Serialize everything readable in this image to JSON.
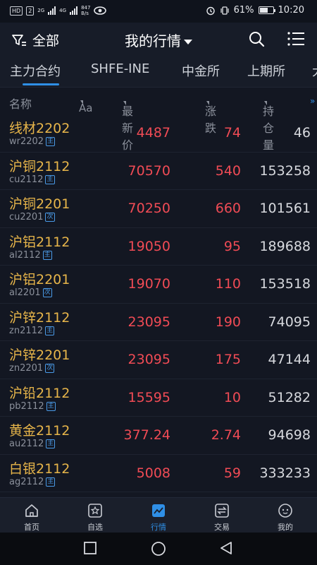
{
  "status_bar": {
    "left_chips": [
      "HD",
      "2"
    ],
    "network_labels": [
      "2G",
      "4G"
    ],
    "speed": "847",
    "speed_unit": "B/s",
    "battery_percent": "61%",
    "battery_level": 0.61,
    "time": "10:20"
  },
  "header": {
    "filter_label": "全部",
    "title": "我的行情"
  },
  "tabs": [
    {
      "label": "主力合约",
      "active": true
    },
    {
      "label": "SHFE-INE",
      "active": false
    },
    {
      "label": "中金所",
      "active": false
    },
    {
      "label": "上期所",
      "active": false
    },
    {
      "label": "大",
      "active": false
    }
  ],
  "columns": {
    "name": "名称",
    "aa": "Aa",
    "price": "最新价",
    "change": "涨跌",
    "open_interest": "持仓量",
    "more": "»"
  },
  "rows": [
    {
      "name": "线材2202",
      "code": "wr2202",
      "badge": "主",
      "price": "4487",
      "change": "74",
      "oi": "46"
    },
    {
      "name": "沪铜2112",
      "code": "cu2112",
      "badge": "主",
      "price": "70570",
      "change": "540",
      "oi": "153258"
    },
    {
      "name": "沪铜2201",
      "code": "cu2201",
      "badge": "次",
      "price": "70250",
      "change": "660",
      "oi": "101561"
    },
    {
      "name": "沪铝2112",
      "code": "al2112",
      "badge": "主",
      "price": "19050",
      "change": "95",
      "oi": "189688"
    },
    {
      "name": "沪铝2201",
      "code": "al2201",
      "badge": "次",
      "price": "19070",
      "change": "110",
      "oi": "153518"
    },
    {
      "name": "沪锌2112",
      "code": "zn2112",
      "badge": "主",
      "price": "23095",
      "change": "190",
      "oi": "74095"
    },
    {
      "name": "沪锌2201",
      "code": "zn2201",
      "badge": "次",
      "price": "23095",
      "change": "175",
      "oi": "47144"
    },
    {
      "name": "沪铅2112",
      "code": "pb2112",
      "badge": "主",
      "price": "15595",
      "change": "10",
      "oi": "51282"
    },
    {
      "name": "黄金2112",
      "code": "au2112",
      "badge": "主",
      "price": "377.24",
      "change": "2.74",
      "oi": "94698"
    },
    {
      "name": "白银2112",
      "code": "ag2112",
      "badge": "主",
      "price": "5008",
      "change": "59",
      "oi": "333233"
    }
  ],
  "bottom_nav": [
    {
      "label": "首页",
      "icon": "home-icon",
      "active": false
    },
    {
      "label": "自选",
      "icon": "star-icon",
      "active": false
    },
    {
      "label": "行情",
      "icon": "market-chart-icon",
      "active": true
    },
    {
      "label": "交易",
      "icon": "trade-arrows-icon",
      "active": false
    },
    {
      "label": "我的",
      "icon": "profile-face-icon",
      "active": false
    }
  ],
  "colors": {
    "up": "#f04b55",
    "name": "#e7b54a",
    "accent": "#2f8fe6",
    "background": "#131722"
  }
}
